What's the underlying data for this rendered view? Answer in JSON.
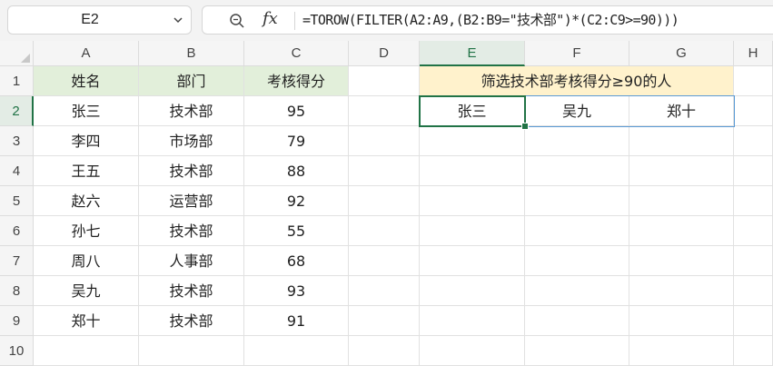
{
  "name_box": "E2",
  "formula_bar": {
    "formula": "=TOROW(FILTER(A2:A9,(B2:B9=\"技术部\")*(C2:C9>=90)))"
  },
  "columns": [
    "A",
    "B",
    "C",
    "D",
    "E",
    "F",
    "G",
    "H"
  ],
  "rows": [
    "1",
    "2",
    "3",
    "4",
    "5",
    "6",
    "7",
    "8",
    "9",
    "10"
  ],
  "table": {
    "headers": [
      "姓名",
      "部门",
      "考核得分"
    ],
    "rows": [
      [
        "张三",
        "技术部",
        "95"
      ],
      [
        "李四",
        "市场部",
        "79"
      ],
      [
        "王五",
        "技术部",
        "88"
      ],
      [
        "赵六",
        "运营部",
        "92"
      ],
      [
        "孙七",
        "技术部",
        "55"
      ],
      [
        "周八",
        "人事部",
        "68"
      ],
      [
        "吴九",
        "技术部",
        "93"
      ],
      [
        "郑十",
        "技术部",
        "91"
      ]
    ]
  },
  "result": {
    "title": "筛选技术部考核得分≥90的人",
    "values": [
      "张三",
      "吴九",
      "郑十"
    ]
  },
  "colors": {
    "header_fill": "#e2efda",
    "result_title_fill": "#fff2cc",
    "selection": "#217346",
    "spill_border": "#5b9bd5"
  },
  "icons": {
    "zoom": "magnifier-icon",
    "function": "fx-icon",
    "dropdown": "chevron-down-icon"
  }
}
